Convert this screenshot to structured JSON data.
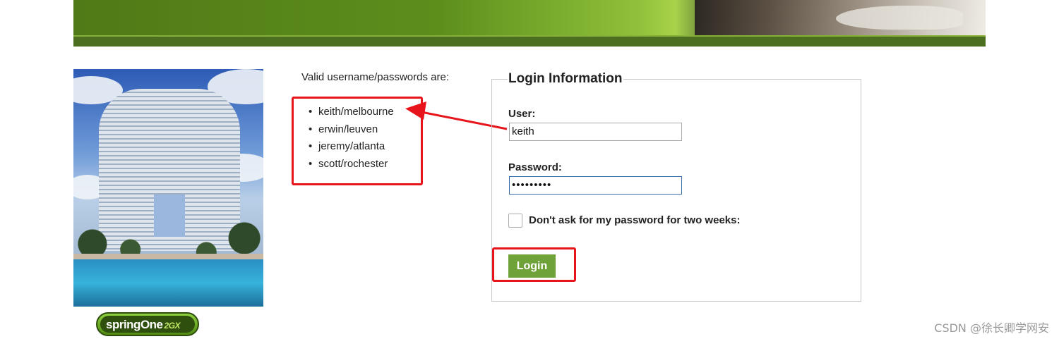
{
  "credentials": {
    "heading": "Valid username/passwords are:",
    "items": [
      "keith/melbourne",
      "erwin/leuven",
      "jeremy/atlanta",
      "scott/rochester"
    ]
  },
  "login": {
    "legend": "Login Information",
    "user_label": "User:",
    "user_value": "keith",
    "password_label": "Password:",
    "password_value": "•••••••••",
    "remember_label": "Don't ask for my password for two weeks:",
    "remember_checked": false,
    "submit_label": "Login"
  },
  "logo": {
    "word": "springOne",
    "tag": "2GX"
  },
  "watermark": "CSDN @徐长卿学网安",
  "colors": {
    "annotation": "#e8141c",
    "button": "#6fa33a",
    "banner": "#5d8e1c"
  }
}
